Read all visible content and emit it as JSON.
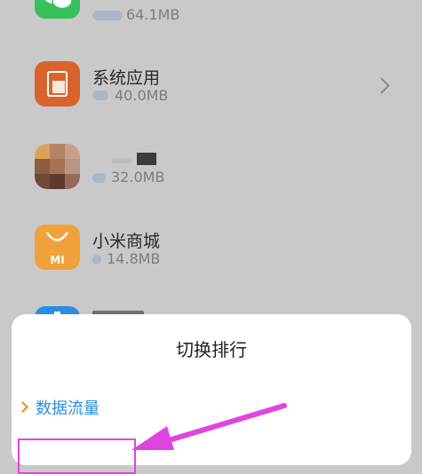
{
  "apps": [
    {
      "name": "",
      "size": "64.1MB",
      "icon": "wechat-icon"
    },
    {
      "name": "系统应用",
      "size": "40.0MB",
      "icon": "system-apps-icon"
    },
    {
      "name": "",
      "size": "32.0MB",
      "icon": "blurred-app-icon"
    },
    {
      "name": "小米商城",
      "size": "14.8MB",
      "icon": "mi-store-icon"
    },
    {
      "name": "",
      "size": "",
      "icon": "blue-app-icon"
    }
  ],
  "sheet": {
    "title": "切换排行",
    "options": [
      {
        "label": "数据流量"
      }
    ]
  },
  "colors": {
    "accent_orange": "#e58a22",
    "option_blue": "#2a8de0",
    "annotation_magenta": "#e044e0"
  }
}
